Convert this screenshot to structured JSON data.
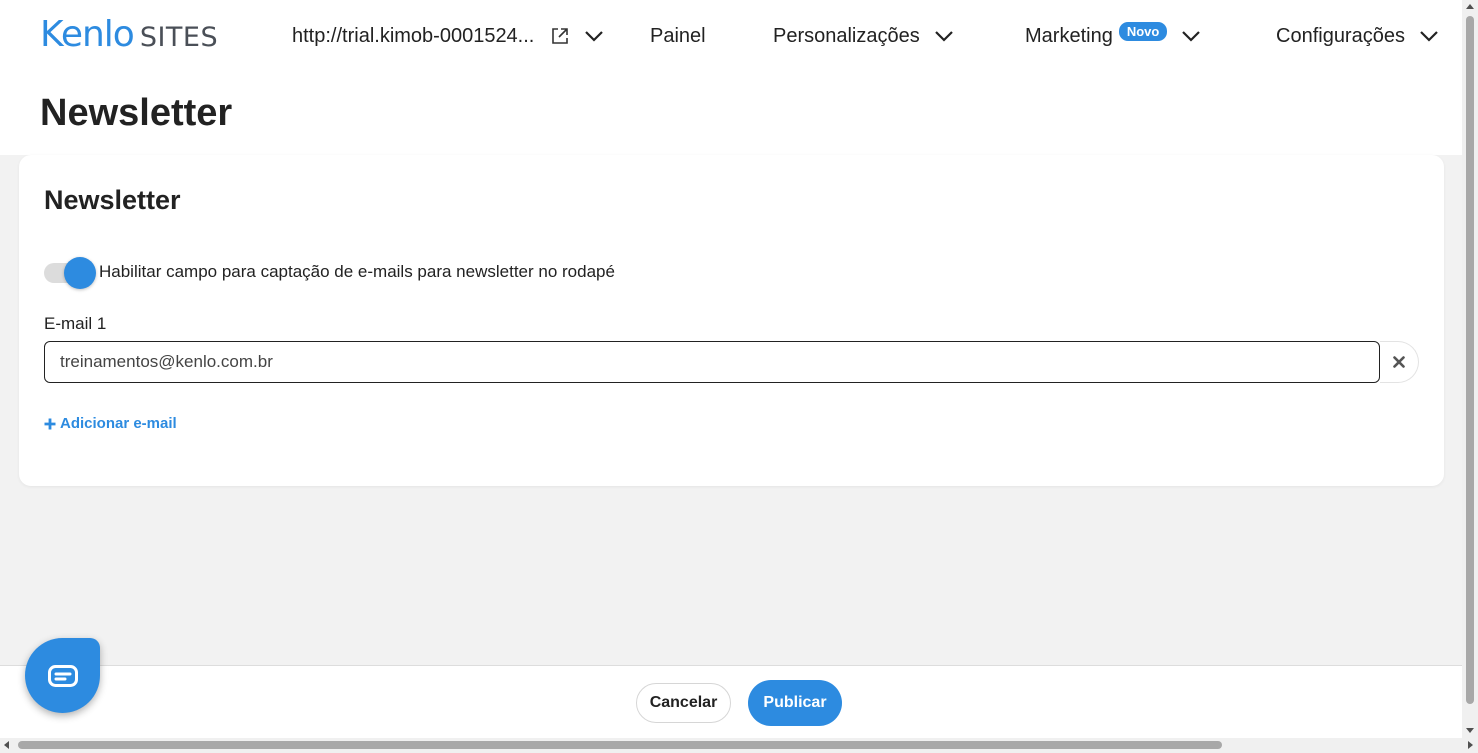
{
  "header": {
    "logo_kenlo": "Kenlo",
    "logo_sites": "SITES",
    "site_url": "http://trial.kimob-0001524...",
    "nav": {
      "painel": "Painel",
      "personalizacoes": "Personalizações",
      "marketing": "Marketing",
      "marketing_badge": "Novo",
      "configuracoes": "Configurações"
    }
  },
  "page": {
    "title": "Newsletter"
  },
  "card": {
    "title": "Newsletter",
    "toggle_label": "Habilitar campo para captação de e-mails para newsletter no rodapé",
    "toggle_on": true,
    "email_label": "E-mail 1",
    "email_value": "treinamentos@kenlo.com.br",
    "add_email_label": "Adicionar e-mail"
  },
  "footer": {
    "cancel_label": "Cancelar",
    "publish_label": "Publicar"
  },
  "colors": {
    "accent": "#2d8be0",
    "background": "#f2f2f2"
  }
}
